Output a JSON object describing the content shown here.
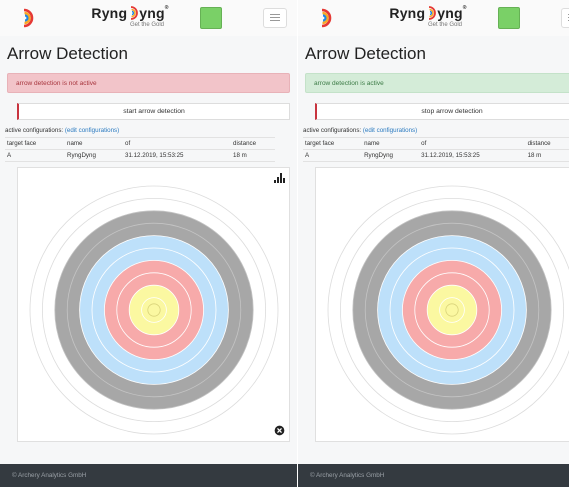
{
  "screens": [
    {
      "brand": "Ryng",
      "brand_suffix": "yng",
      "brand_tm": "®",
      "tagline": "Get the Gold",
      "title": "Arrow Detection",
      "alert_text": "arrow detection is not active",
      "alert_type": "danger",
      "button_label": "start arrow detection",
      "config_prefix": "active configurations: ",
      "config_link": "(edit configurations)",
      "table": {
        "headers": [
          "target face",
          "name",
          "of",
          "distance"
        ],
        "rows": [
          [
            "A",
            "RyngDyng",
            "31.12.2019, 15:53:25",
            "18 m"
          ]
        ]
      },
      "footer": "© Archery Analytics GmbH"
    },
    {
      "brand": "Ryng",
      "brand_suffix": "yng",
      "brand_tm": "®",
      "tagline": "Get the Gold",
      "title": "Arrow Detection",
      "alert_text": "arrow detection is active",
      "alert_type": "success",
      "button_label": "stop arrow detection",
      "config_prefix": "active configurations: ",
      "config_link": "(edit configurations)",
      "table": {
        "headers": [
          "target face",
          "name",
          "of",
          "distance"
        ],
        "rows": [
          [
            "A",
            "RyngDyng",
            "31.12.2019, 15:53:25",
            "18 m"
          ]
        ]
      },
      "footer": "© Archery Analytics GmbH"
    }
  ],
  "colors": {
    "status_green": "#7ad067",
    "danger_bg": "#f2c4c9",
    "success_bg": "#d4ecd8",
    "ring_white": "#ffffff",
    "ring_gray": "#a7a7a7",
    "ring_blue": "#bde0fa",
    "ring_red": "#f7aaaa",
    "ring_yellow": "#fbf8a1",
    "footer_bg": "#343a40"
  },
  "icons": [
    "logo-mark-icon",
    "menu-icon",
    "stats-icon",
    "close-icon"
  ]
}
